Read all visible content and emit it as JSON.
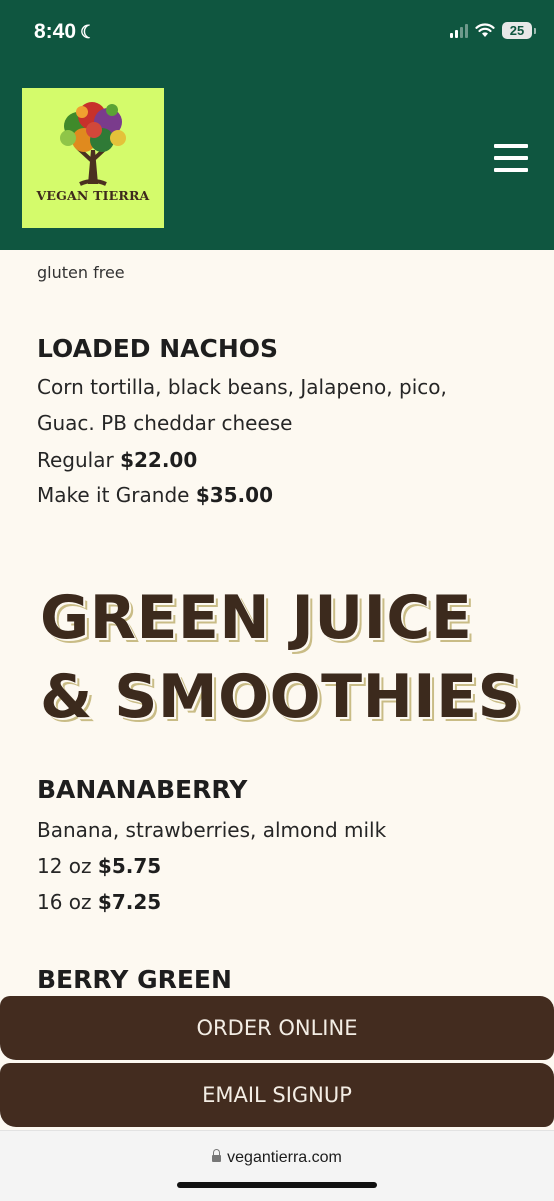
{
  "status_bar": {
    "time": "8:40",
    "battery": "25"
  },
  "header": {
    "logo_text": "VEGAN TIERRA",
    "menu_icon": "hamburger-menu-icon"
  },
  "menu": {
    "top_note": "gluten free",
    "loaded_nachos": {
      "name": "LOADED NACHOS",
      "desc_line_1": "Corn tortilla, black beans, Jalapeno, pico,",
      "desc_line_2": "Guac. PB cheddar cheese",
      "regular_label": "Regular ",
      "regular_price": "$22.00",
      "grande_label": "Make it Grande ",
      "grande_price": "$35.00"
    },
    "section_heading_line_1": "GREEN JUICE",
    "section_heading_line_2": "& SMOOTHIES",
    "bananaberry": {
      "name": "BANANABERRY",
      "desc": "Banana, strawberries, almond milk",
      "size_12_label": "12 oz ",
      "size_12_price": "$5.75",
      "size_16_label": "16 oz ",
      "size_16_price": "$7.25"
    },
    "berry_green": {
      "name": "BERRY GREEN"
    }
  },
  "cta": {
    "order_online": "ORDER ONLINE",
    "email_signup": "EMAIL SIGNUP"
  },
  "browser": {
    "url": "vegantierra.com"
  },
  "colors": {
    "brand_green": "#0f5640",
    "logo_bg": "#d4fb6b",
    "brown": "#432c1f",
    "page_bg": "#fdf9f1"
  }
}
